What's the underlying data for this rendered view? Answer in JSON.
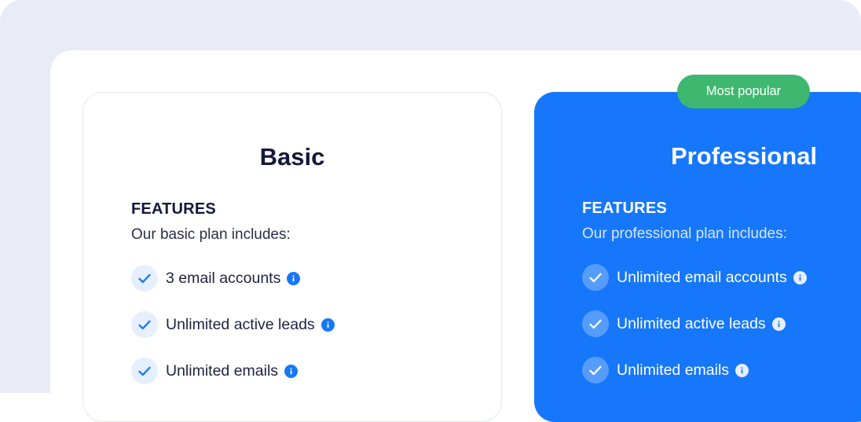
{
  "plans": [
    {
      "name": "Basic",
      "features_label": "FEATURES",
      "features_sub": "Our basic plan includes:",
      "features": [
        {
          "text": "3 email accounts",
          "icon": "check-icon",
          "info_icon": "info-icon"
        },
        {
          "text": "Unlimited active leads",
          "icon": "check-icon",
          "info_icon": "info-icon"
        },
        {
          "text": "Unlimited emails",
          "icon": "check-icon",
          "info_icon": "info-icon"
        }
      ]
    },
    {
      "name": "Professional",
      "badge": "Most popular",
      "features_label": "FEATURES",
      "features_sub": "Our professional plan includes:",
      "features": [
        {
          "text": "Unlimited email accounts",
          "icon": "check-icon",
          "info_icon": "info-icon"
        },
        {
          "text": "Unlimited active leads",
          "icon": "check-icon",
          "info_icon": "info-icon"
        },
        {
          "text": "Unlimited emails",
          "icon": "check-icon",
          "info_icon": "info-icon"
        }
      ]
    }
  ],
  "colors": {
    "accent": "#1677fb",
    "badge": "#3fb86f",
    "backdrop": "#e9ebf6"
  }
}
